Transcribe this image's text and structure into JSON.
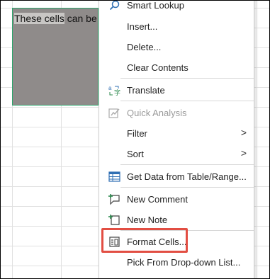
{
  "sheet": {
    "selected_cell_text_part1": "These cells",
    "selected_cell_text_part2": " can be ec"
  },
  "context_menu": {
    "items": [
      {
        "label": "Smart Lookup",
        "icon": "search-icon"
      },
      {
        "label": "Insert..."
      },
      {
        "label": "Delete..."
      },
      {
        "label": "Clear Contents"
      },
      {
        "label": "Translate",
        "icon": "translate-icon"
      },
      {
        "label": "Quick Analysis",
        "icon": "quick-analysis-icon",
        "disabled": true
      },
      {
        "label": "Filter",
        "submenu": true
      },
      {
        "label": "Sort",
        "submenu": true
      },
      {
        "label": "Get Data from Table/Range...",
        "icon": "table-icon"
      },
      {
        "label": "New Comment",
        "icon": "new-comment-icon"
      },
      {
        "label": "New Note",
        "icon": "new-note-icon"
      },
      {
        "label": "Format Cells...",
        "icon": "format-cells-icon",
        "highlighted": true
      },
      {
        "label": "Pick From Drop-down List..."
      }
    ],
    "submenu_arrow": ">",
    "highlight_color": "#e24e43"
  }
}
